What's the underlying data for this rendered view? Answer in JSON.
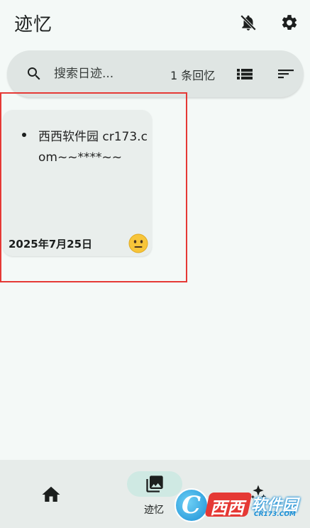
{
  "app": {
    "title": "迹忆"
  },
  "header": {
    "bell_icon": "bell-off-icon",
    "settings_icon": "gear-icon"
  },
  "search": {
    "placeholder": "搜索日迹...",
    "count_text": "1 条回忆"
  },
  "cards": [
    {
      "text": "西西软件园 cr173.com~~****~~",
      "date": "2025年7月25日",
      "mood": "neutral-face-emoji"
    }
  ],
  "bottom_nav": {
    "items": [
      {
        "icon": "home-icon",
        "label": ""
      },
      {
        "icon": "photo-library-icon",
        "label": "迹忆",
        "active": true
      },
      {
        "icon": "sparkle-icon",
        "label": ""
      }
    ]
  },
  "watermark": {
    "brand": "西西",
    "suffix": "软件园",
    "domain": "CR173.COM"
  },
  "colors": {
    "background": "#f4f9f7",
    "search_bg": "#dfe5e3",
    "card_bg": "#e9eeec",
    "active_pill": "#cfe9e3",
    "highlight": "#e53935"
  }
}
